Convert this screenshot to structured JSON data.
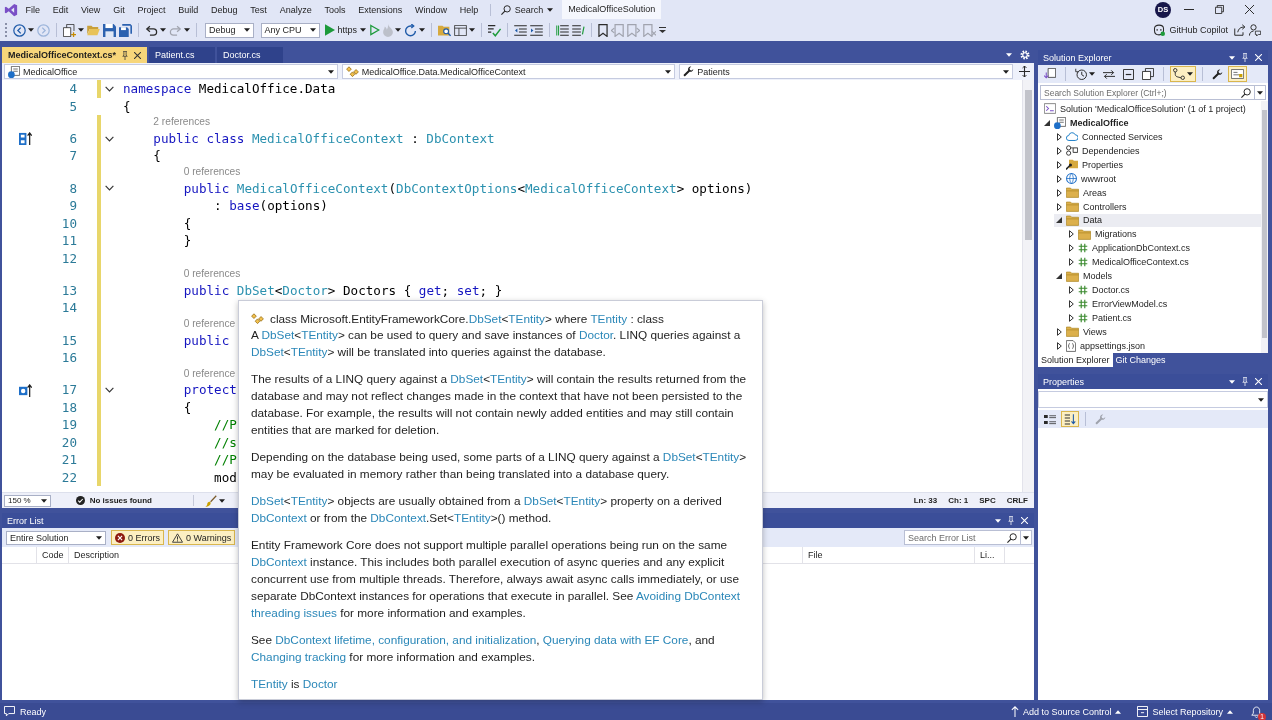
{
  "title_bar": {
    "menu": [
      "File",
      "Edit",
      "View",
      "Git",
      "Project",
      "Build",
      "Debug",
      "Test",
      "Analyze",
      "Tools",
      "Extensions",
      "Window",
      "Help"
    ],
    "search": "Search",
    "solution": "MedicalOfficeSolution",
    "user_initials": "DS"
  },
  "toolbar": {
    "items": [
      {
        "kind": "back",
        "disabled": false,
        "menu": true
      },
      {
        "kind": "forward",
        "disabled": true
      },
      {
        "kind": "separator"
      },
      {
        "kind": "new-item",
        "disabled": false,
        "menu": true
      },
      {
        "kind": "open",
        "disabled": false
      },
      {
        "kind": "save",
        "disabled": false
      },
      {
        "kind": "save-all",
        "disabled": false
      },
      {
        "kind": "separator"
      },
      {
        "kind": "undo",
        "disabled": false,
        "menu": true
      },
      {
        "kind": "redo",
        "disabled": true,
        "menu": true
      },
      {
        "kind": "separator"
      },
      {
        "kind": "dropdown",
        "value": "Debug"
      },
      {
        "kind": "dropdown",
        "value": "Any CPU"
      },
      {
        "kind": "run",
        "label": "https",
        "disabled": false,
        "menu": true
      },
      {
        "kind": "run-no-debug",
        "disabled": false
      },
      {
        "kind": "hot-reload",
        "disabled": true,
        "menu": true
      },
      {
        "kind": "restart",
        "disabled": false,
        "menu": true
      },
      {
        "kind": "separator"
      },
      {
        "kind": "find-folder",
        "disabled": false
      },
      {
        "kind": "layout",
        "disabled": false,
        "menu": true
      },
      {
        "kind": "separator"
      },
      {
        "kind": "spellcheck",
        "disabled": false
      },
      {
        "kind": "separator"
      },
      {
        "kind": "outdent",
        "disabled": false
      },
      {
        "kind": "indent",
        "disabled": false
      },
      {
        "kind": "separator"
      },
      {
        "kind": "comment",
        "disabled": false
      },
      {
        "kind": "uncomment",
        "disabled": false
      },
      {
        "kind": "separator"
      },
      {
        "kind": "bookmark",
        "disabled": false
      },
      {
        "kind": "bookmark-prev",
        "disabled": true
      },
      {
        "kind": "bookmark-next",
        "disabled": true
      },
      {
        "kind": "bookmark-clear",
        "disabled": true
      },
      {
        "kind": "overflow",
        "disabled": false
      }
    ],
    "copilot": "GitHub Copilot"
  },
  "document_tabs": [
    {
      "label": "MedicalOfficeContext.cs*",
      "selected": true
    },
    {
      "label": "Patient.cs",
      "selected": false
    },
    {
      "label": "Doctor.cs",
      "selected": false
    }
  ],
  "navigation_bar": {
    "project": "MedicalOffice",
    "type": "MedicalOffice.Data.MedicalOfficeContext",
    "member": "Patients"
  },
  "editor": {
    "lines": [
      {
        "number": "4",
        "fold": true,
        "modified": true,
        "tokens": [
          {
            "kind": "keyword",
            "text": "namespace"
          },
          {
            "kind": "plain",
            "text": " MedicalOffice.Data"
          }
        ]
      },
      {
        "number": "5",
        "fold": false,
        "modified": false,
        "tokens": [
          {
            "kind": "plain",
            "text": "{"
          }
        ],
        "children": [
          {
            "number": "6",
            "codelens": "2 references",
            "gutter_glyph": {
              "kind": "base-types"
            },
            "fold": true,
            "modified": true,
            "tokens": [
              {
                "kind": "keyword",
                "text": "public class"
              },
              {
                "kind": "type",
                "text": " MedicalOfficeContext"
              },
              {
                "kind": "plain",
                "text": " : "
              },
              {
                "kind": "type",
                "text": "DbContext"
              }
            ]
          },
          {
            "number": "7",
            "fold": false,
            "modified": true,
            "tokens": [
              {
                "kind": "plain",
                "text": "{"
              }
            ],
            "children": [
              {
                "number": "8",
                "codelens": "0 references",
                "fold": true,
                "modified": true,
                "tokens": [
                  {
                    "kind": "keyword",
                    "text": "public"
                  },
                  {
                    "kind": "type",
                    "text": " MedicalOfficeContext"
                  },
                  {
                    "kind": "plain",
                    "text": "("
                  },
                  {
                    "kind": "type",
                    "text": "DbContextOptions"
                  },
                  {
                    "kind": "plain",
                    "text": "<"
                  },
                  {
                    "kind": "type",
                    "text": "MedicalOfficeContext"
                  },
                  {
                    "kind": "plain",
                    "text": "> options)"
                  }
                ],
                "children": [
                  {
                    "number": "9",
                    "fold": false,
                    "modified": true,
                    "tokens": [
                      {
                        "kind": "plain",
                        "text": ": "
                      },
                      {
                        "kind": "keyword",
                        "text": "base"
                      },
                      {
                        "kind": "plain",
                        "text": "(options)"
                      }
                    ]
                  }
                ]
              },
              {
                "number": "10",
                "fold": false,
                "modified": true,
                "tokens": [
                  {
                    "kind": "plain",
                    "text": "{"
                  }
                ]
              },
              {
                "number": "11",
                "fold": false,
                "modified": true,
                "tokens": [
                  {
                    "kind": "plain",
                    "text": "}"
                  }
                ]
              },
              {
                "number": "12",
                "fold": false,
                "modified": true
              },
              {
                "number": "13",
                "codelens": "0 references",
                "fold": false,
                "modified": true,
                "tokens": [
                  {
                    "kind": "keyword",
                    "text": "public"
                  },
                  {
                    "kind": "type",
                    "text": " DbSet"
                  },
                  {
                    "kind": "plain",
                    "text": "<"
                  },
                  {
                    "kind": "type",
                    "text": "Doctor"
                  },
                  {
                    "kind": "plain",
                    "text": "> Doctors { "
                  },
                  {
                    "kind": "keyword",
                    "text": "get"
                  },
                  {
                    "kind": "plain",
                    "text": "; "
                  },
                  {
                    "kind": "keyword",
                    "text": "set"
                  },
                  {
                    "kind": "plain",
                    "text": "; }"
                  }
                ]
              },
              {
                "number": "14",
                "fold": false,
                "modified": true
              },
              {
                "number": "15",
                "codelens": "0 reference",
                "fold": false,
                "modified": true,
                "tokens": [
                  {
                    "kind": "keyword",
                    "text": "public"
                  }
                ]
              },
              {
                "number": "16",
                "fold": false,
                "modified": true
              },
              {
                "number": "17",
                "codelens": "0 reference",
                "gutter_glyph": {
                  "kind": "overrides"
                },
                "fold": true,
                "modified": true,
                "tokens": [
                  {
                    "kind": "keyword",
                    "text": "protect"
                  }
                ]
              },
              {
                "number": "18",
                "fold": false,
                "modified": true,
                "tokens": [
                  {
                    "kind": "plain",
                    "text": "{"
                  }
                ],
                "children": [
                  {
                    "number": "19",
                    "fold": false,
                    "modified": true,
                    "tokens": [
                      {
                        "kind": "comment",
                        "text": "//P"
                      }
                    ]
                  },
                  {
                    "number": "20",
                    "fold": false,
                    "modified": true,
                    "tokens": [
                      {
                        "kind": "comment",
                        "text": "//s"
                      }
                    ]
                  },
                  {
                    "number": "21",
                    "fold": false,
                    "modified": true,
                    "tokens": [
                      {
                        "kind": "comment",
                        "text": "//P"
                      }
                    ]
                  },
                  {
                    "number": "22",
                    "fold": false,
                    "modified": true,
                    "tokens": [
                      {
                        "kind": "plain",
                        "text": "mod"
                      }
                    ]
                  }
                ]
              }
            ]
          }
        ]
      }
    ]
  },
  "quick_info": {
    "signature": [
      {
        "kind": "text",
        "text": "class Microsoft.EntityFrameworkCore."
      },
      {
        "kind": "type",
        "text": "DbSet"
      },
      {
        "kind": "text",
        "text": "<"
      },
      {
        "kind": "type",
        "text": "TEntity"
      },
      {
        "kind": "text",
        "text": "> where "
      },
      {
        "kind": "type",
        "text": "TEntity"
      },
      {
        "kind": "text",
        "text": " : class"
      }
    ],
    "paragraphs": [
      [
        {
          "kind": "text",
          "text": "A "
        },
        {
          "kind": "type",
          "text": "DbSet"
        },
        {
          "kind": "text",
          "text": "<"
        },
        {
          "kind": "type",
          "text": "TEntity"
        },
        {
          "kind": "text",
          "text": "> can be used to query and save instances of "
        },
        {
          "kind": "type",
          "text": "Doctor"
        },
        {
          "kind": "text",
          "text": ". LINQ queries against a "
        },
        {
          "kind": "type",
          "text": "DbSet"
        },
        {
          "kind": "text",
          "text": "<"
        },
        {
          "kind": "type",
          "text": "TEntity"
        },
        {
          "kind": "text",
          "text": "> will be translated into queries against the database."
        }
      ],
      [
        {
          "kind": "text",
          "text": "The results of a LINQ query against a "
        },
        {
          "kind": "type",
          "text": "DbSet"
        },
        {
          "kind": "text",
          "text": "<"
        },
        {
          "kind": "type",
          "text": "TEntity"
        },
        {
          "kind": "text",
          "text": "> will contain the results returned from the database and may not reflect changes made in the context that have not been persisted to the database. For example, the results will not contain newly added entities and may still contain entities that are marked for deletion."
        }
      ],
      [
        {
          "kind": "text",
          "text": "Depending on the database being used, some parts of a LINQ query against a "
        },
        {
          "kind": "type",
          "text": "DbSet"
        },
        {
          "kind": "text",
          "text": "<"
        },
        {
          "kind": "type",
          "text": "TEntity"
        },
        {
          "kind": "text",
          "text": "> may be evaluated in memory rather than being translated into a database query."
        }
      ],
      [
        {
          "kind": "type",
          "text": "DbSet"
        },
        {
          "kind": "text",
          "text": "<"
        },
        {
          "kind": "type",
          "text": "TEntity"
        },
        {
          "kind": "text",
          "text": "> objects are usually obtained from a "
        },
        {
          "kind": "type",
          "text": "DbSet"
        },
        {
          "kind": "text",
          "text": "<"
        },
        {
          "kind": "type",
          "text": "TEntity"
        },
        {
          "kind": "text",
          "text": "> property on a derived "
        },
        {
          "kind": "type",
          "text": "DbContext"
        },
        {
          "kind": "text",
          "text": " or from the "
        },
        {
          "kind": "type",
          "text": "DbContext"
        },
        {
          "kind": "text",
          "text": ".Set<"
        },
        {
          "kind": "type",
          "text": "TEntity"
        },
        {
          "kind": "text",
          "text": ">() method."
        }
      ],
      [
        {
          "kind": "text",
          "text": "Entity Framework Core does not support multiple parallel operations being run on the same "
        },
        {
          "kind": "type",
          "text": "DbContext"
        },
        {
          "kind": "text",
          "text": " instance. This includes both parallel execution of async queries and any explicit concurrent use from multiple threads. Therefore, always await async calls immediately, or use separate DbContext instances for operations that execute in parallel. See "
        },
        {
          "kind": "link",
          "text": "Avoiding DbContext"
        },
        {
          "kind": "link",
          "text": "threading issues"
        },
        {
          "kind": "text",
          "text": " for more information and examples."
        }
      ],
      [
        {
          "kind": "text",
          "text": "See "
        },
        {
          "kind": "link",
          "text": "DbContext lifetime, configuration, and initialization"
        },
        {
          "kind": "text",
          "text": ", "
        },
        {
          "kind": "link",
          "text": "Querying data with EF Core"
        },
        {
          "kind": "text",
          "text": ", and "
        },
        {
          "kind": "link",
          "text": "Changing tracking"
        },
        {
          "kind": "text",
          "text": " for more information and examples."
        }
      ],
      [
        {
          "kind": "type",
          "text": "TEntity"
        },
        {
          "kind": "text",
          "text": " is "
        },
        {
          "kind": "type",
          "text": "Doctor"
        }
      ]
    ]
  },
  "editor_status": {
    "zoom": "150 %",
    "issues": "No issues found",
    "indicators": [
      "Ln: 33",
      "Ch: 1",
      "SPC",
      "CRLF"
    ]
  },
  "error_list": {
    "title": "Error List",
    "scope": "Entire Solution",
    "filters": [
      {
        "kind": "errors",
        "label": "0 Errors",
        "selected": true
      },
      {
        "kind": "warnings",
        "label": "0 Warnings",
        "selected": true
      }
    ],
    "search": {
      "placeholder": "Search Error List"
    },
    "columns": [
      "Code",
      "Description",
      "File",
      "Li..."
    ]
  },
  "solution_explorer": {
    "title": "Solution Explorer",
    "toolbar": [
      {
        "kind": "switch-views",
        "selected": false
      },
      {
        "kind": "separator"
      },
      {
        "kind": "history",
        "selected": false,
        "menu": true
      },
      {
        "kind": "sync",
        "selected": false
      },
      {
        "kind": "collapse-all",
        "selected": false
      },
      {
        "kind": "show-all-files",
        "selected": false
      },
      {
        "kind": "separator"
      },
      {
        "kind": "pending-changes",
        "selected": true,
        "menu": true
      },
      {
        "kind": "separator"
      },
      {
        "kind": "properties",
        "selected": false
      },
      {
        "kind": "preview",
        "selected": true
      }
    ],
    "search": {
      "placeholder": "Search Solution Explorer (Ctrl+;)"
    },
    "tree": [
      {
        "label": "Solution 'MedicalOfficeSolution' (1 of 1 project)",
        "kind": "solution",
        "selected": false,
        "children": [
          {
            "label": "MedicalOffice",
            "kind": "project",
            "expanded": true,
            "selected": false,
            "children": [
              {
                "label": "Connected Services",
                "kind": "connected-services",
                "expanded": false,
                "selected": false
              },
              {
                "label": "Dependencies",
                "kind": "dependencies",
                "expanded": false,
                "selected": false
              },
              {
                "label": "Properties",
                "kind": "properties",
                "expanded": false,
                "selected": false
              },
              {
                "label": "wwwroot",
                "kind": "web-root",
                "expanded": false,
                "selected": false
              },
              {
                "label": "Areas",
                "kind": "folder",
                "expanded": false,
                "selected": false
              },
              {
                "label": "Controllers",
                "kind": "folder",
                "expanded": false,
                "selected": false
              },
              {
                "label": "Data",
                "kind": "folder",
                "expanded": true,
                "selected": true,
                "children": [
                  {
                    "label": "Migrations",
                    "kind": "folder",
                    "expanded": false,
                    "selected": false
                  },
                  {
                    "label": "ApplicationDbContext.cs",
                    "kind": "csharp",
                    "expanded": false,
                    "selected": false
                  },
                  {
                    "label": "MedicalOfficeContext.cs",
                    "kind": "csharp",
                    "expanded": false,
                    "selected": false
                  }
                ]
              },
              {
                "label": "Models",
                "kind": "folder",
                "expanded": true,
                "selected": false,
                "children": [
                  {
                    "label": "Doctor.cs",
                    "kind": "csharp",
                    "expanded": false,
                    "selected": false
                  },
                  {
                    "label": "ErrorViewModel.cs",
                    "kind": "csharp",
                    "expanded": false,
                    "selected": false
                  },
                  {
                    "label": "Patient.cs",
                    "kind": "csharp",
                    "expanded": false,
                    "selected": false
                  }
                ]
              },
              {
                "label": "Views",
                "kind": "folder",
                "expanded": false,
                "selected": false
              },
              {
                "label": "appsettings.json",
                "kind": "json",
                "expanded": false,
                "selected": false
              }
            ]
          }
        ]
      }
    ],
    "tabs": [
      {
        "label": "Solution Explorer",
        "selected": true
      },
      {
        "label": "Git Changes",
        "selected": false
      }
    ]
  },
  "properties": {
    "title": "Properties",
    "toolbar": [
      {
        "kind": "categorized",
        "selected": false,
        "disabled": false
      },
      {
        "kind": "alphabetical",
        "selected": true,
        "disabled": false
      },
      {
        "kind": "separator"
      },
      {
        "kind": "property-pages",
        "selected": false,
        "disabled": true
      }
    ]
  },
  "status_bar": {
    "message": "Ready",
    "source_control": "Add to Source Control",
    "repository": "Select Repository",
    "notifications": "1"
  }
}
